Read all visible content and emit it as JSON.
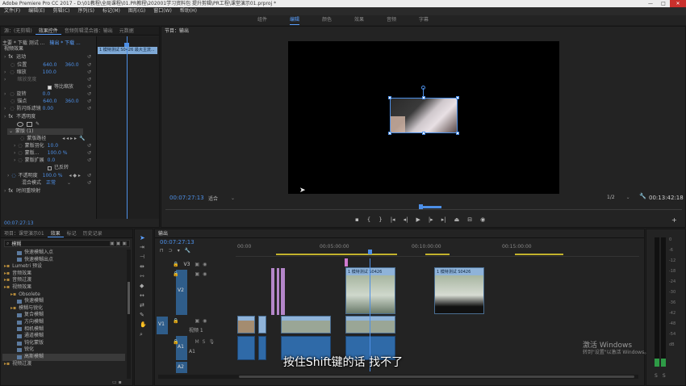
{
  "titlebar": {
    "text": "Adobe Premiere Pro CC 2017 - D:\\01教程\\全局课程\\01.PR教程\\202001学习资料包 提升剪辑\\PR工程\\课堂演示01.prproj *",
    "min": "—",
    "max": "□",
    "close": "✕"
  },
  "menu": [
    "文件(F)",
    "编辑(E)",
    "剪辑(C)",
    "序列(S)",
    "标记(M)",
    "图形(G)",
    "窗口(W)",
    "帮助(H)"
  ],
  "workspaces": [
    "组件",
    "编辑",
    "颜色",
    "效果",
    "音频",
    "字幕"
  ],
  "workspace_active": 1,
  "source_tabs": [
    "源：(无剪辑)",
    "效果控件",
    "音频剪辑混合器：输出",
    "元数据"
  ],
  "effect_controls": {
    "master": "主要 * 下载 测试 ...",
    "clip": "输出 * 下载 ...",
    "mini_clip": "1 模特测试 S0426 最大主流...",
    "section_video": "视频效果",
    "motion": {
      "label": "运动",
      "position_label": "位置",
      "position_x": "640.0",
      "position_y": "360.0",
      "scale_label": "缩放",
      "scale": "100.0",
      "scale_w_label": "缩放宽度",
      "uniform_label": "等比缩放",
      "rotation_label": "旋转",
      "rotation": "0.0",
      "anchor_label": "锚点",
      "anchor_x": "640.0",
      "anchor_y": "360.0",
      "flicker_label": "防闪烁滤镜",
      "flicker": "0.00"
    },
    "opacity_label": "不透明度",
    "mask": {
      "label": "蒙版 (1)",
      "path_label": "蒙版路径",
      "feather_label": "蒙版羽化",
      "feather": "10.0",
      "opacity_label": "蒙版...",
      "opacity": "100.0 %",
      "expand_label": "蒙版扩展",
      "expand": "0.0",
      "invert_label": "已反转"
    },
    "opacity2_label": "不透明度",
    "opacity2": "100.0 %",
    "blend_label": "混合模式",
    "blend": "正常",
    "remap_label": "时间重映射",
    "timecode": "00:07:27:13"
  },
  "program": {
    "tab": "节目：输出",
    "timecode": "00:07:27:13",
    "fit": "适合",
    "quality": "1/2",
    "duration": "00:13:42:18"
  },
  "project": {
    "tabs": [
      "项目：课堂演示01",
      "效果",
      "标记",
      "历史记录"
    ],
    "search": "模糊",
    "items": [
      {
        "label": "快速模糊入点",
        "level": 2,
        "kind": "fx",
        "sel": false
      },
      {
        "label": "快速模糊出点",
        "level": 2,
        "kind": "fx",
        "sel": false
      },
      {
        "label": "Lumetri 预设",
        "level": 0,
        "kind": "bin",
        "sel": false
      },
      {
        "label": "音频效果",
        "level": 0,
        "kind": "bin",
        "sel": false
      },
      {
        "label": "音频过渡",
        "level": 0,
        "kind": "bin",
        "sel": false
      },
      {
        "label": "视频效果",
        "level": 0,
        "kind": "bin",
        "sel": false
      },
      {
        "label": "Obsolete",
        "level": 1,
        "kind": "bin",
        "sel": false
      },
      {
        "label": "快速模糊",
        "level": 2,
        "kind": "fx",
        "sel": false
      },
      {
        "label": "模糊与锐化",
        "level": 1,
        "kind": "bin",
        "sel": false
      },
      {
        "label": "复合模糊",
        "level": 2,
        "kind": "fx",
        "sel": false
      },
      {
        "label": "方向模糊",
        "level": 2,
        "kind": "fx",
        "sel": false
      },
      {
        "label": "相机模糊",
        "level": 2,
        "kind": "fx",
        "sel": false
      },
      {
        "label": "通道模糊",
        "level": 2,
        "kind": "fx",
        "sel": false
      },
      {
        "label": "钝化蒙版",
        "level": 2,
        "kind": "fx",
        "sel": false
      },
      {
        "label": "锐化",
        "level": 2,
        "kind": "fx",
        "sel": false
      },
      {
        "label": "高斯模糊",
        "level": 2,
        "kind": "fx",
        "sel": true
      },
      {
        "label": "视频过渡",
        "level": 0,
        "kind": "bin",
        "sel": false
      }
    ]
  },
  "timeline": {
    "tab": "输出",
    "timecode": "00:07:27:13",
    "ruler": [
      "00:00",
      "00:05:00:00",
      "00:10:00:00",
      "00:15:00:00"
    ],
    "tracks": {
      "v3": "V3",
      "v2": "V2",
      "v1": "V1",
      "v1_name": "视频 1",
      "a1": "A1",
      "a1_name": "A1",
      "a2": "A2"
    },
    "clip_title": "1 模特测试 S0426",
    "clip_title2": "1 模特测试 S0426"
  },
  "meter": {
    "labels": [
      "0",
      "-6",
      "-12",
      "-18",
      "-24",
      "-30",
      "-36",
      "-42",
      "-48",
      "-54",
      "dB"
    ],
    "solo": [
      "S",
      "S"
    ]
  },
  "watermark": {
    "line1": "激活 Windows",
    "line2": "转到\"设置\"以激活 Windows。"
  },
  "subtitle": "按住Shift键的话 找不了",
  "colors": {
    "accent": "#4d8fe6",
    "playhead": "#4d8fe6",
    "clip_video": "#8fb3d9",
    "clip_audio": "#2f6aa8",
    "clip_pink": "#b486c9"
  }
}
